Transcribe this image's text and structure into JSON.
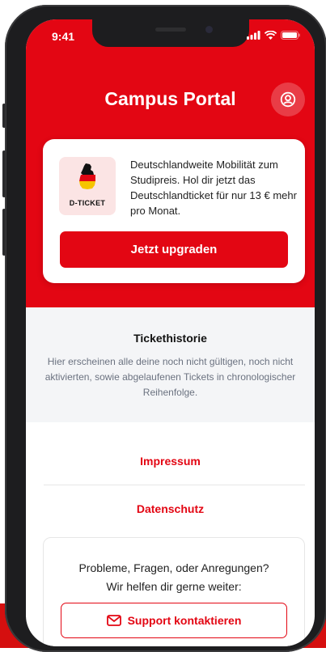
{
  "status_bar": {
    "time": "9:41"
  },
  "header": {
    "title": "Campus Portal",
    "profile_icon": "user-circle-icon"
  },
  "promo": {
    "ticket_label": "D-TICKET",
    "text": "Deutschlandweite Mobilität zum Studipreis. Hol dir jetzt das Deutschlandticket für nur 13 € mehr pro Monat.",
    "button_label": "Jetzt upgraden"
  },
  "history": {
    "title": "Tickethistorie",
    "text": "Hier erscheinen alle deine noch nicht gültigen, noch nicht aktivierten, sowie abgelaufenen Tickets in chronologischer Reihenfolge."
  },
  "links": {
    "impressum": "Impressum",
    "datenschutz": "Datenschutz"
  },
  "support": {
    "line1": "Probleme, Fragen, oder Anregungen?",
    "line2": "Wir helfen dir gerne weiter:",
    "button_label": "Support kontaktieren",
    "button_icon": "mail-icon"
  },
  "colors": {
    "accent": "#e30613",
    "muted_bg": "#f4f5f7",
    "muted_text": "#6b7280"
  }
}
